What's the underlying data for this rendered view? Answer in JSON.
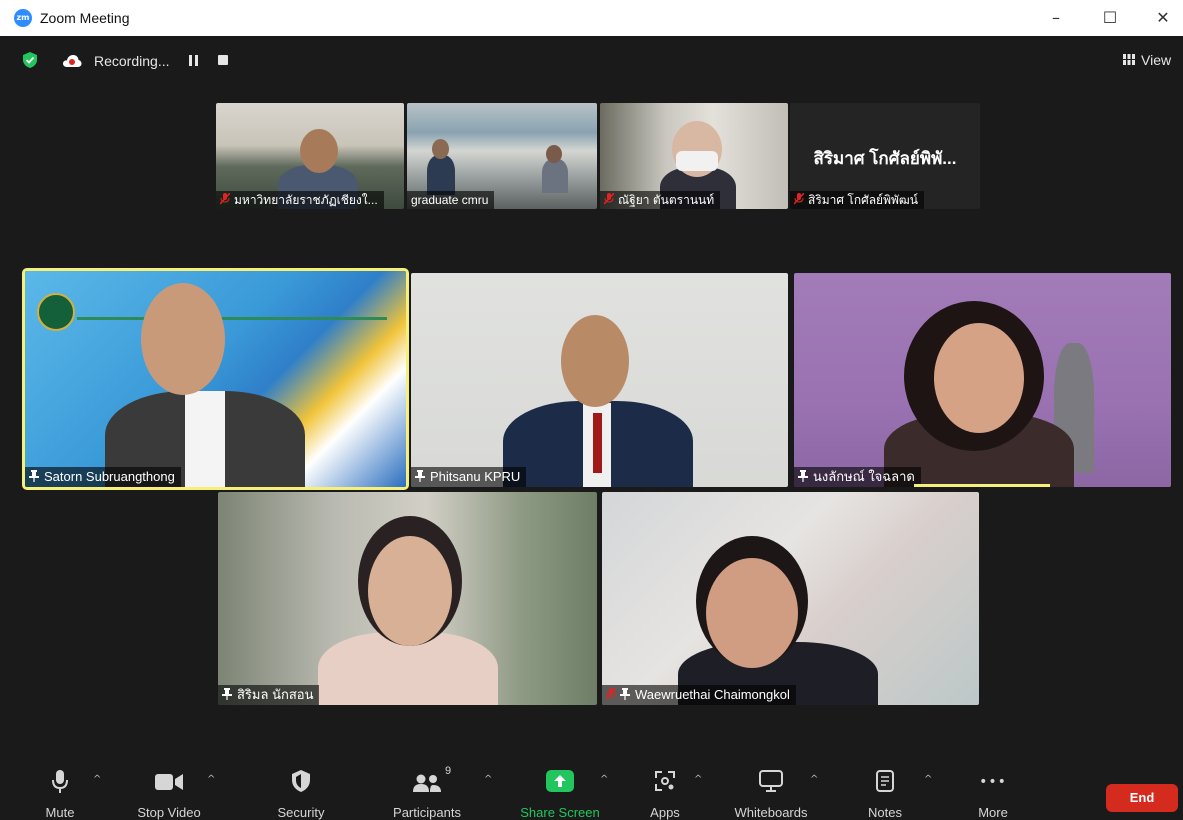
{
  "window": {
    "title": "Zoom Meeting",
    "logo_text": "zm",
    "minimize": "–",
    "maximize": "☐",
    "close": "✕"
  },
  "topbar": {
    "recording_label": "Recording...",
    "view_label": "View"
  },
  "tiles": [
    {
      "name": "มหาวิทยาลัยราชภัฏเชียงใ...",
      "muted": true,
      "pinned": false
    },
    {
      "name": "graduate cmru",
      "muted": false,
      "pinned": false
    },
    {
      "name": "ณัฐิยา ตันตรานนท์",
      "muted": true,
      "pinned": false
    },
    {
      "name": "สิริมาศ โกศัลย์พิพัฒน์",
      "avatar_name": "สิริมาศ โกศัลย์พิพั...",
      "muted": true,
      "pinned": false
    },
    {
      "name": "Satorn Subruangthong",
      "muted": false,
      "pinned": true,
      "active_speaker": true
    },
    {
      "name": "Phitsanu KPRU",
      "muted": false,
      "pinned": true
    },
    {
      "name": "นงลักษณ์ ใจฉลาด",
      "muted": false,
      "pinned": true
    },
    {
      "name": "สิริมล นักสอน",
      "muted": false,
      "pinned": true
    },
    {
      "name": "Waewruethai Chaimongkol",
      "muted": true,
      "pinned": true
    }
  ],
  "toolbar": {
    "mute": "Mute",
    "stop_video": "Stop Video",
    "security": "Security",
    "participants": "Participants",
    "participants_count": "9",
    "share_screen": "Share Screen",
    "apps": "Apps",
    "whiteboards": "Whiteboards",
    "notes": "Notes",
    "more": "More",
    "more_dots": "•••",
    "end": "End",
    "caret": "^"
  },
  "colors": {
    "accent": "#2D8CFF",
    "share_green": "#23c55e",
    "end_red": "#d52b1e",
    "active_speaker": "#f6f07a",
    "background": "#1a1a1a"
  }
}
